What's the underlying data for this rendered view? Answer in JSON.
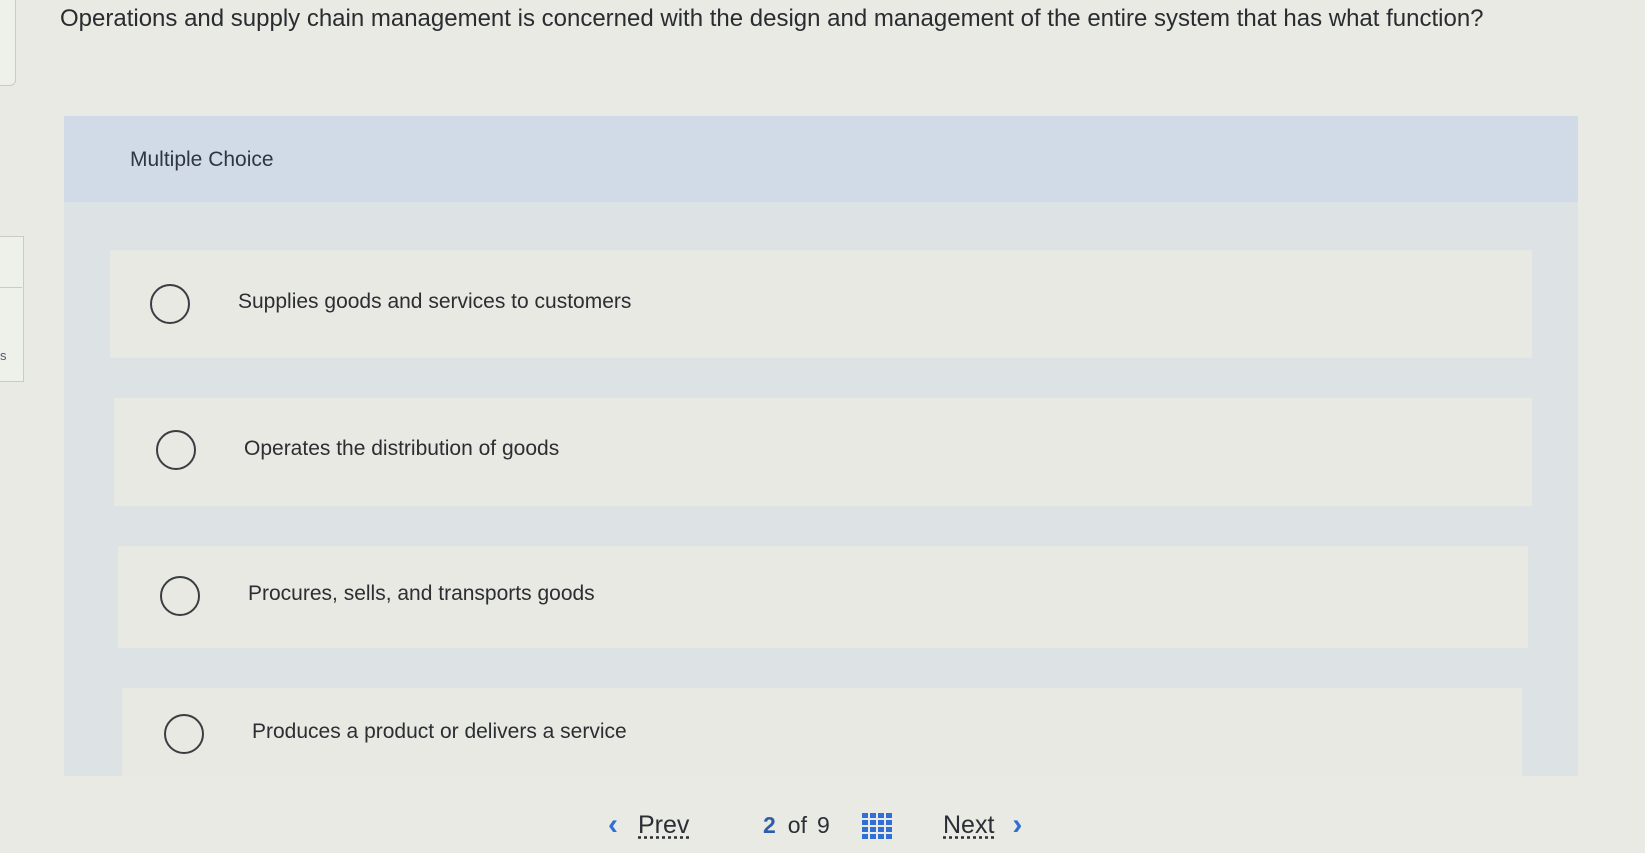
{
  "question": {
    "text": "Operations and supply chain management is concerned with the design and management of the entire system that has what function?"
  },
  "left_edge": {
    "letter": "s"
  },
  "multiple_choice": {
    "label": "Multiple Choice",
    "options": [
      {
        "text": "Supplies goods and services to customers"
      },
      {
        "text": "Operates the distribution of goods"
      },
      {
        "text": "Procures, sells, and transports goods"
      },
      {
        "text": "Produces a product or delivers a service"
      }
    ]
  },
  "pager": {
    "prev_label": "Prev",
    "next_label": "Next",
    "current": "2",
    "of_label": "of",
    "total": "9"
  },
  "colors": {
    "accent": "#2f6fd6",
    "header_band": "#d1dbe7",
    "background": "#e8eae3"
  }
}
